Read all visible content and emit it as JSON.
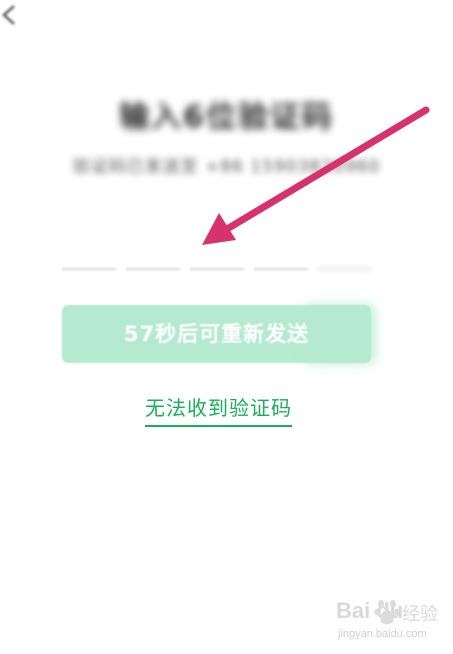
{
  "header": {
    "back_icon": "chevron-left-icon"
  },
  "page": {
    "title": "输入6位验证码",
    "subtitle": "验证码已发送至 +86 15903830960"
  },
  "code_input": {
    "length": 5
  },
  "resend": {
    "label": "57秒后可重新发送",
    "bg_color": "#b5ead0",
    "text_color": "#ffffff"
  },
  "help_link": {
    "label": "无法收到验证码",
    "color": "#1aad5e"
  },
  "annotation": {
    "arrow_color": "#d6336e",
    "arrow_icon": "pointer-arrow-icon"
  },
  "watermark": {
    "brand": "Bai du",
    "cn": "经验",
    "url": "jingyan.baidu.com",
    "icon": "baidu-paw-icon"
  }
}
